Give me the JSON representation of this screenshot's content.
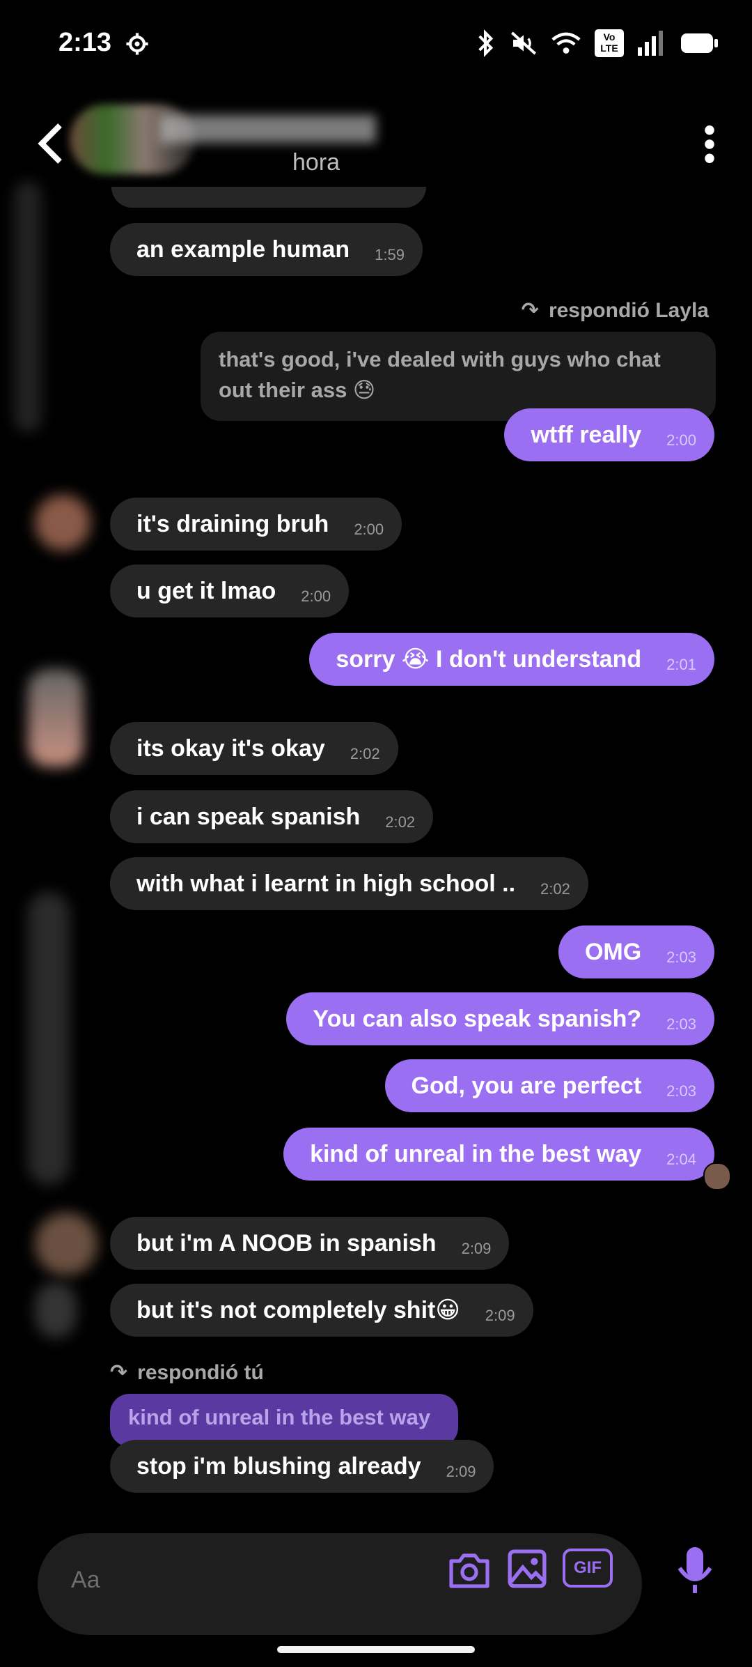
{
  "status_bar": {
    "time": "2:13",
    "volte": "Vo\nLTE"
  },
  "header": {
    "subtitle": "hora"
  },
  "messages": [
    {
      "side": "in",
      "text": "an example human",
      "time": "1:59"
    },
    {
      "side": "in-reply-label",
      "text": "respondió Layla"
    },
    {
      "side": "quote",
      "text": "that's good, i've dealed with guys who chat out their ass 😓"
    },
    {
      "side": "out",
      "text": "wtff really",
      "time": "2:00"
    },
    {
      "side": "in",
      "text": "it's draining bruh",
      "time": "2:00"
    },
    {
      "side": "in",
      "text": "u get it lmao",
      "time": "2:00"
    },
    {
      "side": "out",
      "text": "sorry 😭 I don't understand",
      "time": "2:01"
    },
    {
      "side": "in",
      "text": "its okay it's okay",
      "time": "2:02"
    },
    {
      "side": "in",
      "text": "i can speak spanish",
      "time": "2:02"
    },
    {
      "side": "in",
      "text": "with what i learnt in high school ..",
      "time": "2:02"
    },
    {
      "side": "out",
      "text": "OMG",
      "time": "2:03"
    },
    {
      "side": "out",
      "text": "You can also speak spanish?",
      "time": "2:03"
    },
    {
      "side": "out",
      "text": "God, you are perfect",
      "time": "2:03"
    },
    {
      "side": "out",
      "text": "kind of unreal in the best way",
      "time": "2:04"
    },
    {
      "side": "in",
      "text": "but i'm A NOOB in spanish",
      "time": "2:09"
    },
    {
      "side": "in",
      "text": "but it's  not completely shit😀",
      "time": "2:09"
    },
    {
      "side": "reply-label",
      "text": "respondió tú"
    },
    {
      "side": "quote-out",
      "text": "kind of unreal in the best way"
    },
    {
      "side": "in",
      "text": "stop i'm blushing already",
      "time": "2:09"
    }
  ],
  "composer": {
    "placeholder": "Aa",
    "gif_label": "GIF"
  },
  "colors": {
    "accent": "#9b6ff2",
    "incoming": "#262626",
    "background": "#000000"
  }
}
